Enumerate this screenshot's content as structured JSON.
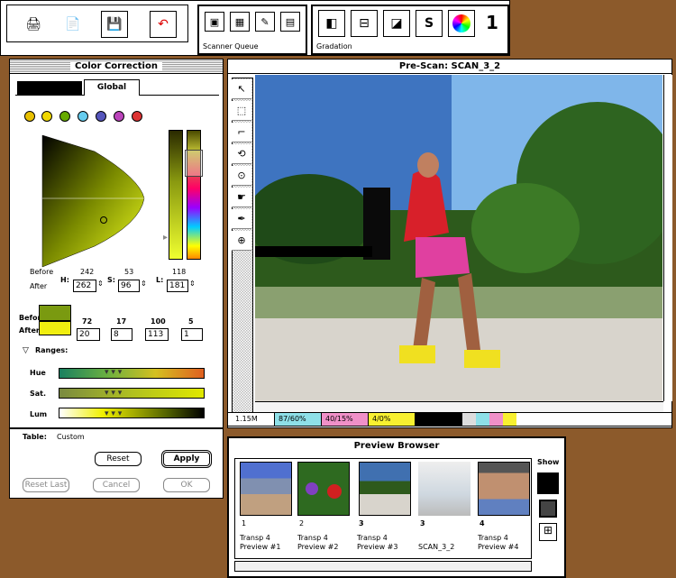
{
  "toolbar": {
    "scanner_queue": "Scanner Queue",
    "gradation": "Gradation",
    "count": "1"
  },
  "color_correction": {
    "title": "Color Correction",
    "tab": "Global",
    "labels": {
      "before": "Before",
      "after": "After",
      "h": "H:",
      "s": "S:",
      "l": "L:"
    },
    "before_vals": {
      "h": "242",
      "s": "53",
      "l": "118"
    },
    "after_vals": {
      "h": "262",
      "s": "96",
      "l": "181"
    },
    "swatch_labels": {
      "before": "Befor",
      "after": "After"
    },
    "channel_before": [
      "72",
      "17",
      "100",
      "5"
    ],
    "channel_after": [
      "20",
      "8",
      "113",
      "1"
    ],
    "ranges_label": "Ranges:",
    "range_labels": [
      "Hue",
      "Sat.",
      "Lum"
    ],
    "table_label": "Table:",
    "table_value": "Custom",
    "buttons": {
      "reset": "Reset",
      "apply": "Apply",
      "reset_last": "Reset Last",
      "cancel": "Cancel",
      "ok": "OK"
    }
  },
  "prescan": {
    "title": "Pre-Scan: SCAN_3_2",
    "status": [
      "1.15M",
      "87/60%",
      "40/15%",
      "4/0%"
    ]
  },
  "preview_browser": {
    "title": "Preview Browser",
    "show": "Show",
    "thumbs": [
      {
        "num": "1",
        "cap1": "Transp 4",
        "cap2": "Preview #1"
      },
      {
        "num": "2",
        "cap1": "Transp 4",
        "cap2": "Preview #2"
      },
      {
        "num": "3",
        "cap1": "Transp 4",
        "cap2": "Preview #3"
      },
      {
        "num": "3",
        "cap1": "",
        "cap2": "SCAN_3_2"
      },
      {
        "num": "4",
        "cap1": "Transp 4",
        "cap2": "Preview #4"
      }
    ]
  }
}
